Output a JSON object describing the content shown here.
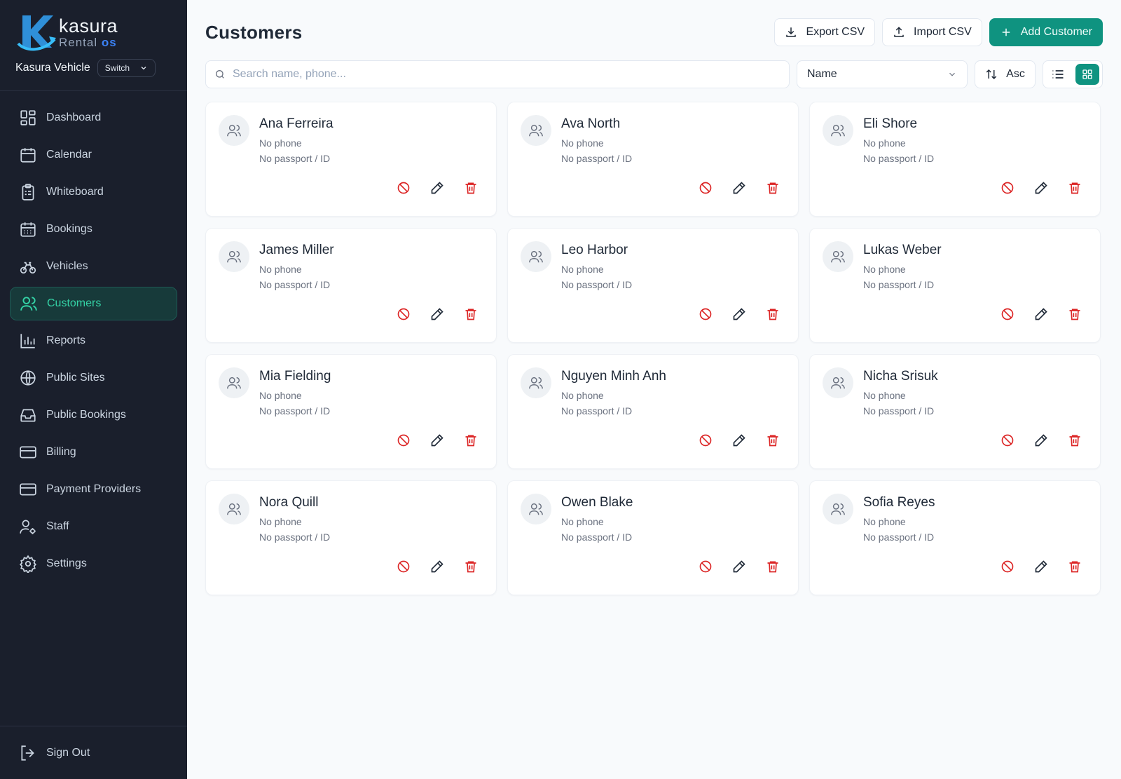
{
  "brand": {
    "logo_line1": "kasura",
    "logo_line2_a": "Rental ",
    "logo_line2_b": "os",
    "org_name": "Kasura Vehicle",
    "switch_label": "Switch"
  },
  "nav": [
    {
      "label": "Dashboard",
      "icon": "dashboard-icon"
    },
    {
      "label": "Calendar",
      "icon": "calendar-icon"
    },
    {
      "label": "Whiteboard",
      "icon": "clipboard-icon"
    },
    {
      "label": "Bookings",
      "icon": "calendar-grid-icon"
    },
    {
      "label": "Vehicles",
      "icon": "bike-icon"
    },
    {
      "label": "Customers",
      "icon": "users-icon",
      "active": true
    },
    {
      "label": "Reports",
      "icon": "bar-chart-icon"
    },
    {
      "label": "Public Sites",
      "icon": "globe-icon"
    },
    {
      "label": "Public Bookings",
      "icon": "inbox-icon"
    },
    {
      "label": "Billing",
      "icon": "credit-card-icon"
    },
    {
      "label": "Payment Providers",
      "icon": "credit-card-icon"
    },
    {
      "label": "Staff",
      "icon": "user-cog-icon"
    },
    {
      "label": "Settings",
      "icon": "gear-icon"
    }
  ],
  "signout_label": "Sign Out",
  "header": {
    "title": "Customers",
    "export_label": "Export CSV",
    "import_label": "Import CSV",
    "add_label": "Add Customer"
  },
  "toolbar": {
    "search_placeholder": "Search name, phone...",
    "sort_value": "Name",
    "order_label": "Asc",
    "view_mode": "grid"
  },
  "customers": [
    {
      "name": "Ana Ferreira",
      "phone": "No phone",
      "passport": "No passport / ID"
    },
    {
      "name": "Ava North",
      "phone": "No phone",
      "passport": "No passport / ID"
    },
    {
      "name": "Eli Shore",
      "phone": "No phone",
      "passport": "No passport / ID"
    },
    {
      "name": "James Miller",
      "phone": "No phone",
      "passport": "No passport / ID"
    },
    {
      "name": "Leo Harbor",
      "phone": "No phone",
      "passport": "No passport / ID"
    },
    {
      "name": "Lukas Weber",
      "phone": "No phone",
      "passport": "No passport / ID"
    },
    {
      "name": "Mia Fielding",
      "phone": "No phone",
      "passport": "No passport / ID"
    },
    {
      "name": "Nguyen Minh Anh",
      "phone": "No phone",
      "passport": "No passport / ID"
    },
    {
      "name": "Nicha Srisuk",
      "phone": "No phone",
      "passport": "No passport / ID"
    },
    {
      "name": "Nora Quill",
      "phone": "No phone",
      "passport": "No passport / ID"
    },
    {
      "name": "Owen Blake",
      "phone": "No phone",
      "passport": "No passport / ID"
    },
    {
      "name": "Sofia Reyes",
      "phone": "No phone",
      "passport": "No passport / ID"
    }
  ],
  "colors": {
    "sidebar_bg": "#1a1f2c",
    "accent": "#0f9380",
    "active_text": "#34d3a6",
    "danger": "#dc2626"
  }
}
